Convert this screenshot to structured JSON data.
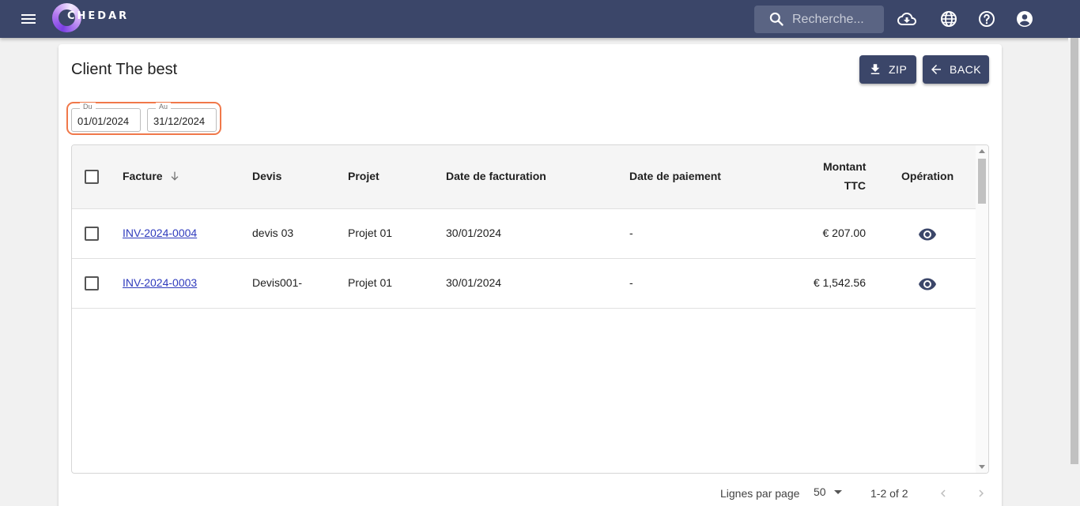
{
  "header": {
    "logo_text": "CHEDAR",
    "search_placeholder": "Recherche...",
    "icons": [
      "menu-icon",
      "cloud-download-icon",
      "globe-icon",
      "help-icon",
      "account-icon"
    ]
  },
  "page": {
    "title": "Client The best",
    "zip_label": "ZIP",
    "back_label": "BACK"
  },
  "filters": {
    "from_label": "Du",
    "from_value": "01/01/2024",
    "to_label": "Au",
    "to_value": "31/12/2024"
  },
  "table": {
    "columns": {
      "facture": "Facture",
      "devis": "Devis",
      "projet": "Projet",
      "date_facturation": "Date de facturation",
      "date_paiement": "Date de paiement",
      "montant_line1": "Montant",
      "montant_line2": "TTC",
      "operation": "Opération"
    },
    "rows": [
      {
        "facture": "INV-2024-0004",
        "devis": "devis 03",
        "projet": "Projet 01",
        "date_facturation": "30/01/2024",
        "date_paiement": "-",
        "montant": "€ 207.00"
      },
      {
        "facture": "INV-2024-0003",
        "devis": "Devis001-",
        "projet": "Projet 01",
        "date_facturation": "30/01/2024",
        "date_paiement": "-",
        "montant": "€ 1,542.56"
      }
    ]
  },
  "footer": {
    "rows_per_page_label": "Lignes par page",
    "rows_per_page_value": "50",
    "range": "1-2 of 2"
  },
  "colors": {
    "topbar": "#3b4669",
    "accent_highlight": "#f0784a",
    "link": "#2f3bbd"
  }
}
